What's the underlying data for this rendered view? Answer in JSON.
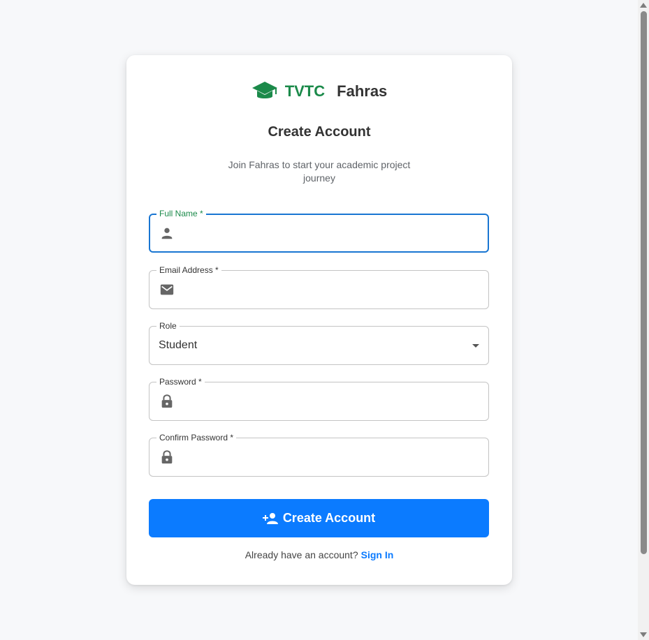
{
  "brand": {
    "short": "TVTC",
    "name": "Fahras",
    "icon": "graduation-cap-icon",
    "color": "#1b8a4a"
  },
  "title": "Create Account",
  "subtitle": "Join Fahras to start your academic project journey",
  "fields": {
    "full_name": {
      "label": "Full Name",
      "required_mark": "*",
      "value": "",
      "icon": "person-icon",
      "focused": true
    },
    "email": {
      "label": "Email Address",
      "required_mark": "*",
      "value": "",
      "icon": "envelope-icon"
    },
    "role": {
      "label": "Role",
      "value": "Student"
    },
    "password": {
      "label": "Password",
      "required_mark": "*",
      "value": "",
      "icon": "lock-icon"
    },
    "confirm_password": {
      "label": "Confirm Password",
      "required_mark": "*",
      "value": "",
      "icon": "lock-icon"
    }
  },
  "submit": {
    "label": "Create Account",
    "icon": "add-person-icon",
    "color": "#0b7bff"
  },
  "signin": {
    "prompt": "Already have an account?",
    "link": "Sign In"
  },
  "colors": {
    "focus_border": "#1976d2",
    "background": "#f7f8fa"
  }
}
